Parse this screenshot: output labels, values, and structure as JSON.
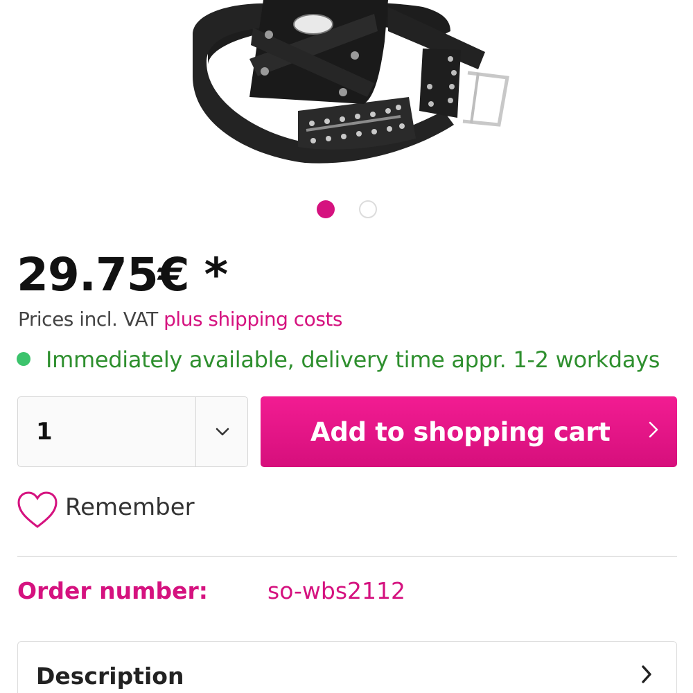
{
  "gallery": {
    "image_alt": "Black leather tool belt with pouch",
    "dots": [
      {
        "active": true
      },
      {
        "active": false
      }
    ]
  },
  "product": {
    "price": "29.75€ *",
    "vat_text": "Prices incl. VAT ",
    "shipping_link": "plus shipping costs",
    "availability": "Immediately available, delivery time appr. 1-2 workdays",
    "availability_color": "#2e8f2e",
    "accent_color": "#d5127f"
  },
  "buy_box": {
    "quantity": "1",
    "add_to_cart_label": "Add to shopping cart"
  },
  "wishlist": {
    "label": "Remember",
    "icon": "heart-icon"
  },
  "details": {
    "order_number_label": "Order number:",
    "order_number_value": "so-wbs2112"
  },
  "accordion": {
    "description_label": "Description"
  }
}
